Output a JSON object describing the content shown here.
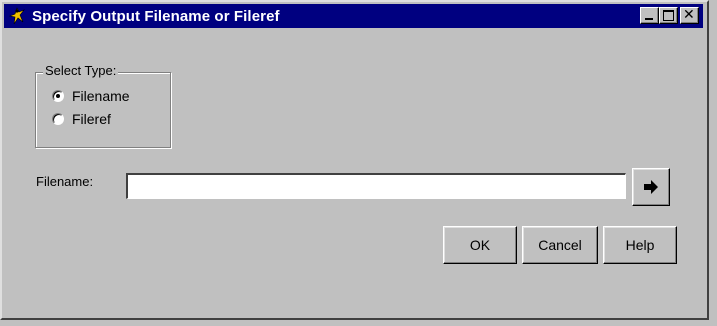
{
  "window": {
    "title": "Specify Output Filename or Fileref",
    "icon": "sas-figure-icon",
    "controls": [
      "minimize",
      "maximize",
      "close"
    ],
    "close_glyph": "✕"
  },
  "select_type": {
    "legend": "Select Type:",
    "options": [
      {
        "label": "Filename",
        "selected": true
      },
      {
        "label": "Fileref",
        "selected": false
      }
    ]
  },
  "filename": {
    "label": "Filename:",
    "value": "",
    "browse_icon": "arrow-right-icon"
  },
  "buttons": {
    "ok": "OK",
    "cancel": "Cancel",
    "help": "Help"
  },
  "colors": {
    "title_bar": "#000080",
    "face": "#c0c0c0"
  }
}
